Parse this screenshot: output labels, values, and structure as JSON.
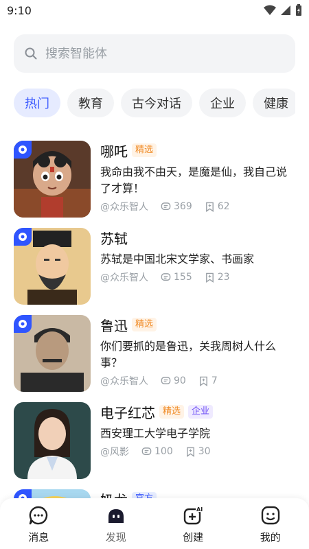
{
  "status_bar": {
    "time": "9:10"
  },
  "search": {
    "placeholder": "搜索智能体"
  },
  "tabs": [
    {
      "label": "热门",
      "active": true
    },
    {
      "label": "教育",
      "active": false
    },
    {
      "label": "古今对话",
      "active": false
    },
    {
      "label": "企业",
      "active": false
    },
    {
      "label": "健康",
      "active": false
    }
  ],
  "agents": [
    {
      "name": "哪吒",
      "tags": [
        "精选"
      ],
      "desc": "我命由我不由天，是魔是仙，我自己说了才算！",
      "author": "@众乐智人",
      "comments": "369",
      "favorites": "62"
    },
    {
      "name": "苏轼",
      "tags": [],
      "desc": "苏轼是中国北宋文学家、书画家",
      "author": "@众乐智人",
      "comments": "155",
      "favorites": "23"
    },
    {
      "name": "鲁迅",
      "tags": [
        "精选"
      ],
      "desc": "你们要抓的是鲁迅，关我周树人什么事？",
      "author": "@众乐智人",
      "comments": "90",
      "favorites": "7"
    },
    {
      "name": "电子红芯",
      "tags": [
        "精选",
        "企业"
      ],
      "desc": "西安理工大学电子学院",
      "author": "@风影",
      "comments": "100",
      "favorites": "30"
    },
    {
      "name": "奶龙",
      "tags": [
        "官方"
      ],
      "desc": "",
      "author": "",
      "comments": "",
      "favorites": ""
    }
  ],
  "bottom_nav": [
    {
      "label": "消息",
      "icon": "message-icon"
    },
    {
      "label": "发现",
      "icon": "discover-icon",
      "active": true
    },
    {
      "label": "创建",
      "icon": "create-ai-icon"
    },
    {
      "label": "我的",
      "icon": "profile-icon"
    }
  ],
  "colors": {
    "accent": "#3a59ff",
    "tab_active_bg": "#e6ebff",
    "tag_featured": "#f08a24",
    "tag_enterprise": "#6b4cf5"
  }
}
